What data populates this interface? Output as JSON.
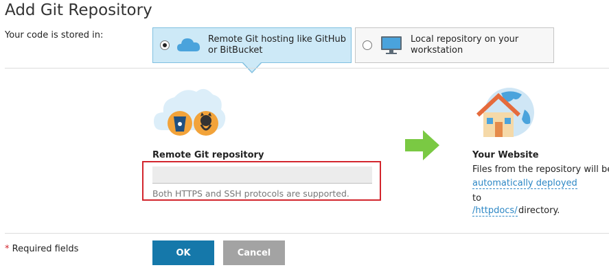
{
  "title": "Add Git Repository",
  "stored_label": "Your code is stored in:",
  "options": [
    {
      "label": "Remote Git hosting like GitHub or BitBucket",
      "selected": true,
      "icon": "cloud-icon"
    },
    {
      "label": "Local repository on your workstation",
      "selected": false,
      "icon": "monitor-icon"
    }
  ],
  "remote": {
    "label": "Remote Git repository",
    "value": "",
    "hint": "Both HTTPS and SSH protocols are supported."
  },
  "website": {
    "title": "Your Website",
    "line1": "Files from the repository will be",
    "link1": "automatically deployed",
    "to": "to",
    "link2": "/httpdocs/",
    "tail": "directory."
  },
  "required_star": "*",
  "required_text": " Required fields",
  "buttons": {
    "ok": "OK",
    "cancel": "Cancel"
  },
  "colors": {
    "accent": "#1578aa",
    "selected_bg": "#cde9f7",
    "error_frame": "#d2242c",
    "arrow": "#7ac943",
    "link": "#2c87c5"
  }
}
